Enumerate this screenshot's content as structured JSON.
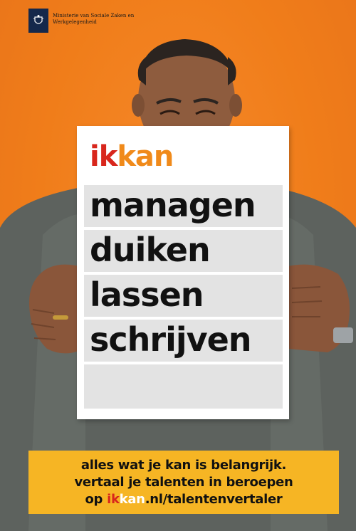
{
  "header": {
    "ministry_line1": "Ministerie van Sociale Zaken en",
    "ministry_line2": "Werkgelegenheid",
    "logo_icon": "crest-icon"
  },
  "sign": {
    "brand_ik": "ik",
    "brand_kan": "kan",
    "rows": [
      "managen",
      "duiken",
      "lassen",
      "schrijven",
      ""
    ]
  },
  "banner": {
    "line1": "alles wat je kan is belangrijk.",
    "line2": "vertaal je talenten in beroepen",
    "line3_prefix": "op ",
    "line3_ik": "ik",
    "line3_kan": "kan",
    "line3_suffix": ".nl/talentenvertaler"
  },
  "colors": {
    "background": "#f07d1a",
    "banner": "#f6b524",
    "ik_red": "#d8261c",
    "kan_orange": "#f08a1a",
    "gov_blue": "#15284b"
  }
}
